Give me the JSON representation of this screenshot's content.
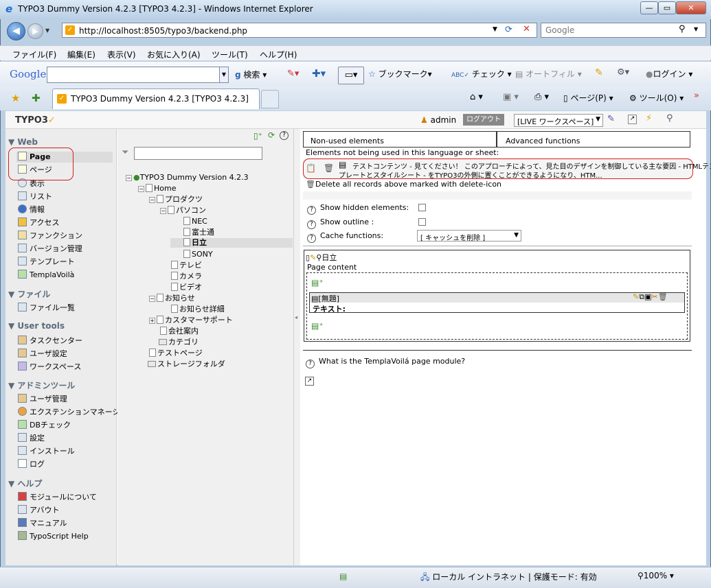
{
  "window": {
    "title": "TYPO3 Dummy Version 4.2.3 [TYPO3 4.2.3] - Windows Internet Explorer",
    "minimize": "—",
    "maximize": "▭",
    "close": "✕"
  },
  "nav": {
    "url": "http://localhost:8505/typo3/backend.php",
    "search_placeholder": "Google"
  },
  "menu": [
    "ファイル(F)",
    "編集(E)",
    "表示(V)",
    "お気に入り(A)",
    "ツール(T)",
    "ヘルプ(H)"
  ],
  "google_toolbar": {
    "logo": "Google",
    "search_button": "検索",
    "bookmarks": "ブックマーク",
    "check": "チェック",
    "autofill": "オートフィル",
    "login": "ログイン"
  },
  "tab": {
    "title": "TYPO3 Dummy Version 4.2.3 [TYPO3 4.2.3]",
    "page_menu": "ページ(P)",
    "tools_menu": "ツール(O)"
  },
  "typo3_header": {
    "logo": "TYPO3",
    "user": "admin",
    "logout": "ログアウト",
    "workspace": "[LIVE ワークスペース]"
  },
  "modules": {
    "web": {
      "title": "Web",
      "items": [
        "Page",
        "ページ",
        "表示",
        "リスト",
        "情報",
        "アクセス",
        "ファンクション",
        "バージョン管理",
        "テンプレート",
        "TemplaVoilà"
      ]
    },
    "file": {
      "title": "ファイル",
      "items": [
        "ファイル一覧"
      ]
    },
    "user": {
      "title": "User tools",
      "items": [
        "タスクセンター",
        "ユーザ設定",
        "ワークスペース"
      ]
    },
    "admin": {
      "title": "アドミンツール",
      "items": [
        "ユーザ管理",
        "エクステンションマネージャ",
        "DBチェック",
        "設定",
        "インストール",
        "ログ"
      ]
    },
    "help": {
      "title": "ヘルプ",
      "items": [
        "モジュールについて",
        "アバウト",
        "マニュアル",
        "TypoScript Help"
      ]
    }
  },
  "tree": {
    "filter_value": "",
    "root": "TYPO3 Dummy Version 4.2.3",
    "nodes": [
      "Home",
      "プロダクツ",
      "パソコン",
      "NEC",
      "富士通",
      "日立",
      "SONY",
      "テレビ",
      "カメラ",
      "ビデオ",
      "お知らせ",
      "お知らせ詳細",
      "カスタマーサポート",
      "会社案内",
      "カテゴリ",
      "テストページ",
      "ストレージフォルダ"
    ]
  },
  "main": {
    "tab_unused": "Non-used elements",
    "tab_advanced": "Advanced functions",
    "unused_note": "Elements not being used in this language or sheet:",
    "unused_element_line1": "テストコンテンツ - 見てください！ このアプローチによって、見た目のデザインを制御している主な要因 - HTMLテン",
    "unused_element_line2": "プレートとスタイルシート - をTYPO3の外側に置くことができるようになり、HTM...",
    "delete_all": "Delete all records above marked with delete-icon",
    "show_hidden": "Show hidden elements:",
    "show_outline": "Show outline :",
    "cache_functions": "Cache functions:",
    "cache_select": "[ キャッシュを削除 ]",
    "page_name": "日立",
    "page_content": "Page content",
    "element_title": "[無題]",
    "element_text": "テキスト:",
    "help_link": "What is the TemplaVoilá page module?"
  },
  "status": {
    "zone": "ローカル イントラネット | 保護モード: 有効",
    "zoom": "100%"
  }
}
